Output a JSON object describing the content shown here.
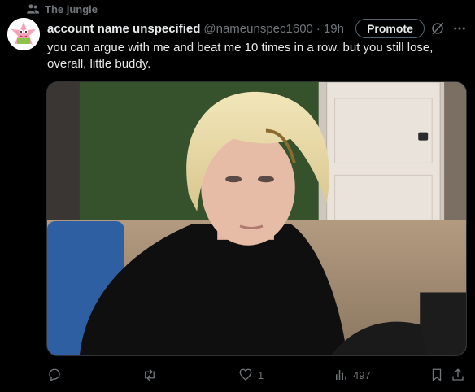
{
  "context": {
    "icon": "people-icon",
    "label": "The jungle"
  },
  "tweet": {
    "display_name": "account name unspecified",
    "handle": "@nameunspec1600",
    "separator": "·",
    "time": "19h",
    "text": "you can argue with me and beat me 10 times in a row. but you still lose, overall, little buddy.",
    "promote_label": "Promote",
    "avatar_icon": "starfish-avatar-icon",
    "media_description_icon": "photo-icon"
  },
  "actions": {
    "reply": {
      "icon": "reply-icon",
      "count": ""
    },
    "repost": {
      "icon": "repost-icon",
      "count": ""
    },
    "like": {
      "icon": "heart-icon",
      "count": "1"
    },
    "views": {
      "icon": "views-icon",
      "count": "497"
    },
    "bookmark": {
      "icon": "bookmark-icon"
    },
    "share": {
      "icon": "share-icon"
    }
  },
  "colors": {
    "background": "#000000",
    "text": "#e7e9ea",
    "muted": "#71767b",
    "border": "#536471"
  }
}
